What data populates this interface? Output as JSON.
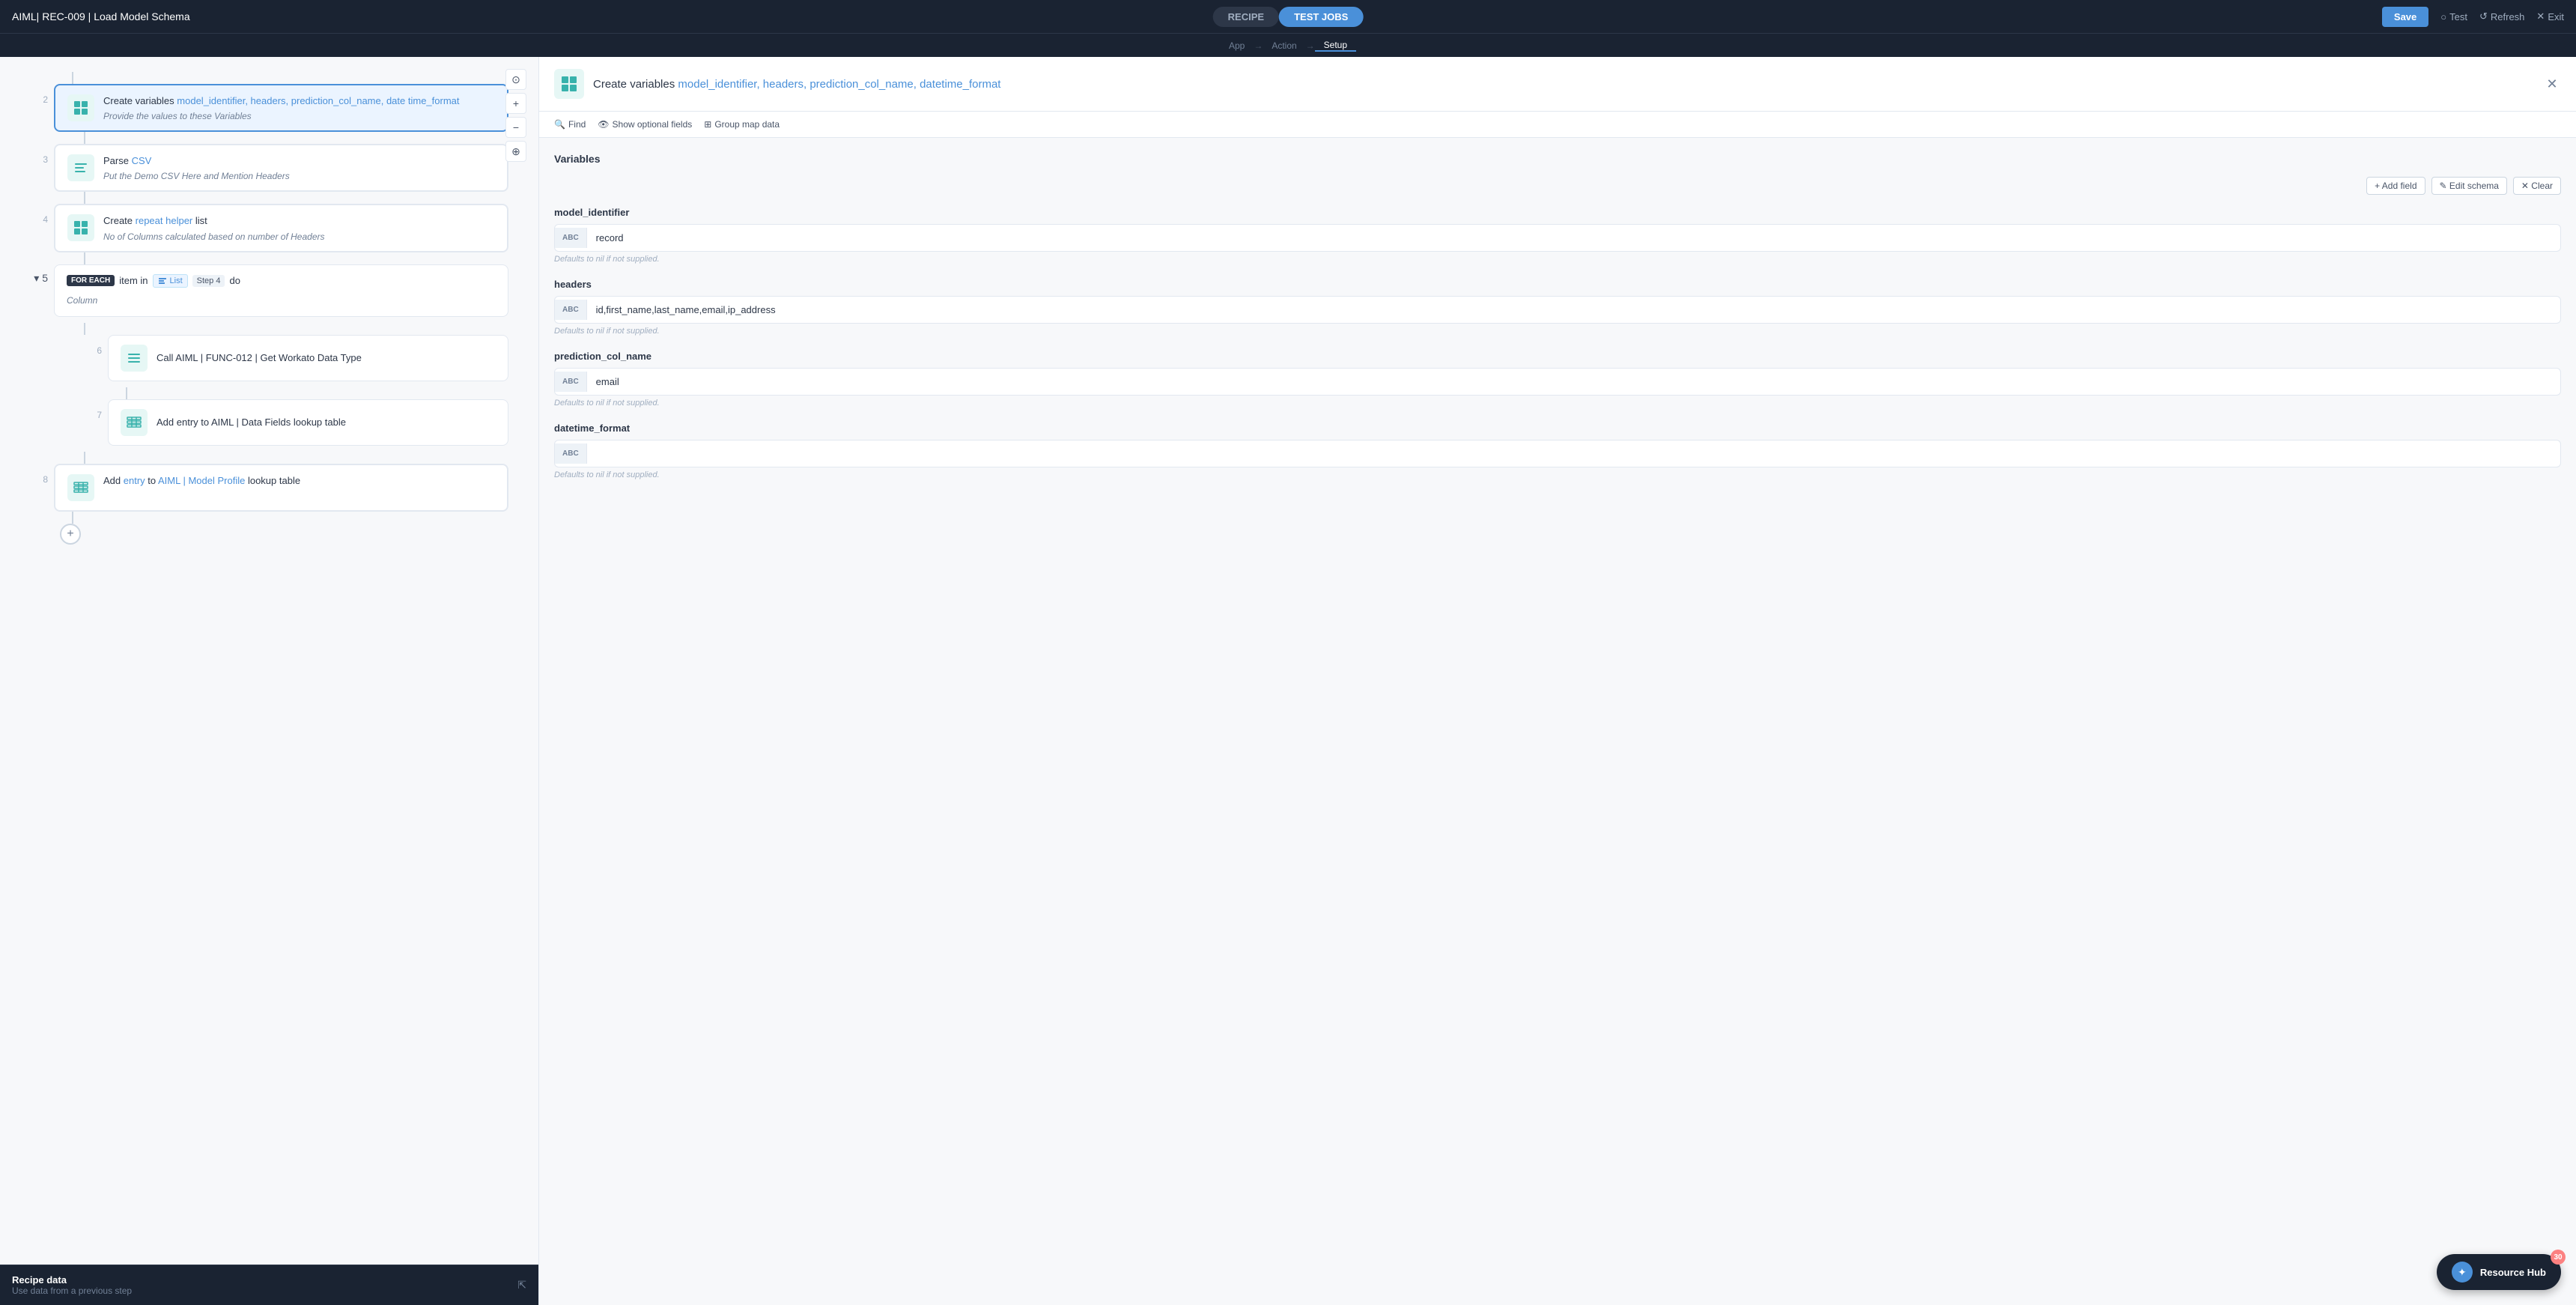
{
  "topNav": {
    "title": "AIML| REC-009 | Load Model Schema",
    "saveLabel": "Save",
    "testLabel": "Test",
    "refreshLabel": "Refresh",
    "exitLabel": "Exit",
    "tabRecipe": "RECIPE",
    "tabTestJobs": "TEST JOBS"
  },
  "subNav": {
    "items": [
      {
        "label": "App",
        "active": false
      },
      {
        "label": "Action",
        "active": false
      },
      {
        "label": "Setup",
        "active": true
      }
    ]
  },
  "canvas": {
    "steps": [
      {
        "number": "2",
        "type": "action",
        "iconType": "teal",
        "iconSymbol": "⊞",
        "title": "Create variables model_identifier, headers, prediction_col_name, date time_format",
        "desc": "Provide the values to these Variables",
        "active": true
      },
      {
        "number": "3",
        "type": "action",
        "iconType": "teal",
        "iconSymbol": "⊟",
        "title": "Parse CSV",
        "desc": "Put the Demo CSV Here and Mention Headers",
        "active": false
      },
      {
        "number": "4",
        "type": "action",
        "iconType": "teal",
        "iconSymbol": "⊞",
        "title": "Create repeat helper list No of Columns calculated based on number of Headers",
        "titleParts": {
          "pre": "Create ",
          "link": "repeat helper",
          "post": " list"
        },
        "desc": "No of Columns calculated based on number of Headers",
        "active": false
      }
    ],
    "foreach": {
      "number": "5",
      "collapsed": true,
      "badgeForeach": "FOR EACH",
      "itemText": "item in",
      "badgeList": "List",
      "badgeStep": "Step 4",
      "doText": "do",
      "desc": "Column",
      "nested": [
        {
          "number": "6",
          "title": "Call AIML | FUNC-012 | Get Workato Data Type",
          "titleParts": {
            "pre": "Call ",
            "link": "AIML | FUNC-012 | Get Workato Data Type"
          }
        },
        {
          "number": "7",
          "title": "Add entry to AIML | Data Fields lookup table",
          "titleParts": {
            "pre": "Add ",
            "link1": "entry",
            "mid": " to ",
            "link2": "AIML | Data Fields",
            "post": " lookup table"
          }
        }
      ]
    },
    "stepAfter": {
      "number": "8",
      "title": "Add entry to AIML | Model Profile lookup table",
      "titleParts": {
        "pre": "Add ",
        "link1": "entry",
        "mid": " to ",
        "link2": "AIML | Model Profile",
        "post": " lookup table"
      }
    },
    "recipeData": {
      "title": "Recipe data",
      "desc": "Use data from a previous step"
    }
  },
  "setup": {
    "title": "Create variables model_identifier, headers, prediction_col_name, datetime_format",
    "titleParts": {
      "pre": "Create variables ",
      "link": "model_identifier, headers, prediction_col_name, datetime_format"
    },
    "iconSymbol": "⊞",
    "toolbar": {
      "findLabel": "Find",
      "optionalLabel": "Show optional fields",
      "groupLabel": "Group map data"
    },
    "sectionTitle": "Variables",
    "addFieldLabel": "+ Add field",
    "editSchemaLabel": "✎ Edit schema",
    "clearLabel": "✕ Clear",
    "variables": [
      {
        "name": "model_identifier",
        "typeBadge": "ABC",
        "value": "record",
        "hint": "Defaults to nil if not supplied."
      },
      {
        "name": "headers",
        "typeBadge": "ABC",
        "value": "id,first_name,last_name,email,ip_address",
        "hint": "Defaults to nil if not supplied."
      },
      {
        "name": "prediction_col_name",
        "typeBadge": "ABC",
        "value": "email",
        "hint": "Defaults to nil if not supplied."
      },
      {
        "name": "datetime_format",
        "typeBadge": "ABC",
        "value": "",
        "hint": "Defaults to nil if not supplied."
      }
    ]
  },
  "resourceHub": {
    "label": "Resource Hub",
    "badge": "30",
    "iconSymbol": "✦"
  }
}
